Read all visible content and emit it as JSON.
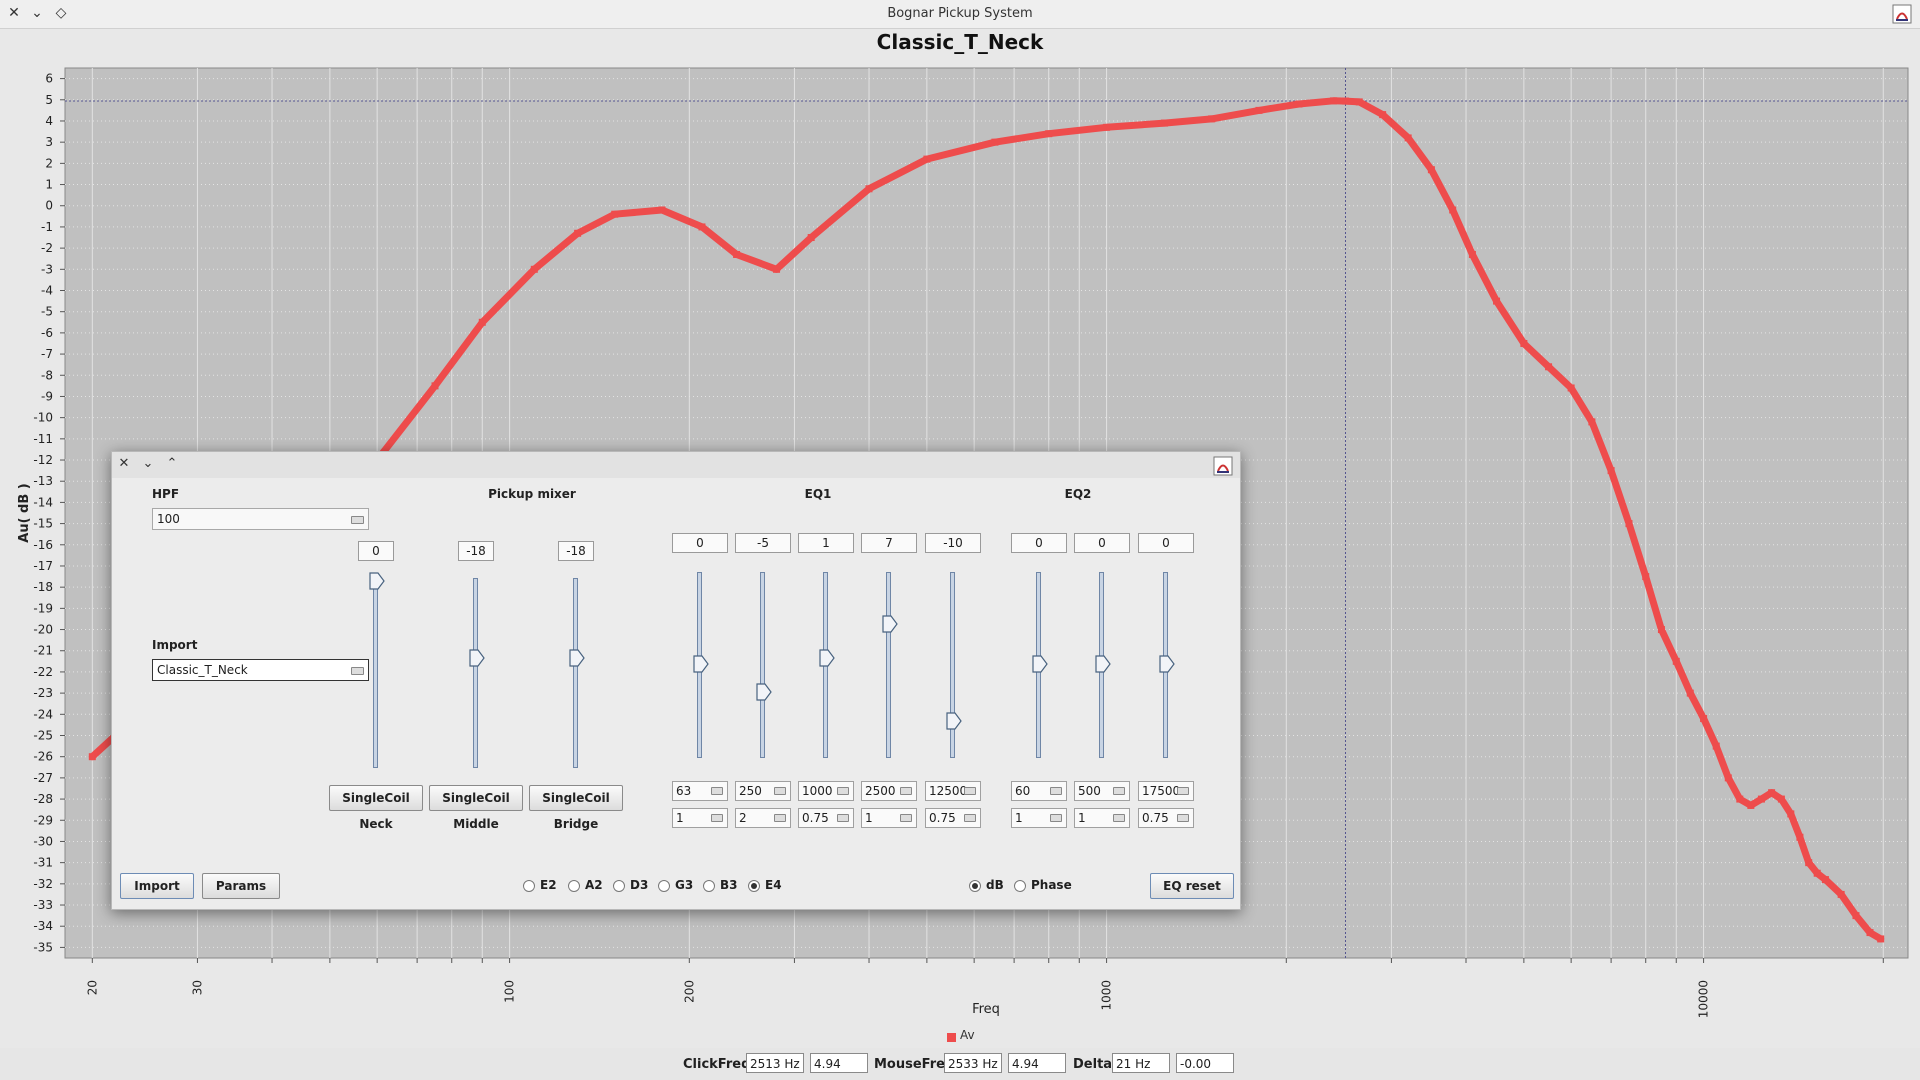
{
  "window": {
    "title": "Bognar Pickup System"
  },
  "chart_data": {
    "type": "line",
    "title": "Classic_T_Neck",
    "xlabel": "Freq",
    "ylabel": "Au( dB )",
    "x_scale": "log",
    "xlim": [
      18,
      22000
    ],
    "ylim": [
      -35.5,
      6.5
    ],
    "x_ticks": [
      20,
      30,
      100,
      200,
      1000,
      10000
    ],
    "y_ticks": [
      6,
      5,
      4,
      3,
      2,
      1,
      0,
      -1,
      -2,
      -3,
      -4,
      -5,
      -6,
      -7,
      -8,
      -9,
      -10,
      -11,
      -12,
      -13,
      -14,
      -15,
      -16,
      -17,
      -18,
      -19,
      -20,
      -21,
      -22,
      -23,
      -24,
      -25,
      -26,
      -27,
      -28,
      -29,
      -30,
      -31,
      -32,
      -33,
      -34,
      -35
    ],
    "grid": true,
    "crosshair": {
      "x": 2513,
      "y": 4.94
    },
    "legend": {
      "position": "bottom-center"
    },
    "series": [
      {
        "name": "Av",
        "color": "#ee4c4c",
        "x": [
          20,
          25,
          32,
          40,
          50,
          60,
          75,
          90,
          110,
          130,
          150,
          180,
          210,
          240,
          280,
          320,
          400,
          500,
          650,
          800,
          1000,
          1250,
          1500,
          1800,
          2100,
          2400,
          2513,
          2650,
          2900,
          3200,
          3500,
          3800,
          4100,
          4500,
          5000,
          5500,
          6000,
          6500,
          7000,
          7500,
          8000,
          8500,
          9000,
          9500,
          10000,
          10500,
          11000,
          11500,
          12000,
          12500,
          13000,
          13500,
          14000,
          14500,
          15000,
          15500,
          16000,
          17000,
          18000,
          19000,
          19800
        ],
        "values": [
          -26,
          -23.5,
          -20.5,
          -17.5,
          -14.5,
          -12,
          -8.5,
          -5.5,
          -3,
          -1.3,
          -0.4,
          -0.2,
          -1,
          -2.3,
          -3,
          -1.5,
          0.8,
          2.2,
          3,
          3.4,
          3.7,
          3.9,
          4.1,
          4.5,
          4.8,
          4.95,
          4.94,
          4.9,
          4.3,
          3.2,
          1.7,
          -0.2,
          -2.3,
          -4.5,
          -6.5,
          -7.6,
          -8.6,
          -10.2,
          -12.5,
          -15,
          -17.5,
          -20,
          -21.5,
          -23,
          -24.2,
          -25.5,
          -27,
          -28,
          -28.3,
          -28,
          -27.7,
          -28,
          -28.7,
          -29.8,
          -31,
          -31.5,
          -31.8,
          -32.5,
          -33.5,
          -34.3,
          -34.6
        ]
      }
    ]
  },
  "status": {
    "clickfreq_label": "ClickFreq:",
    "clickfreq_hz": "2513 Hz",
    "clickfreq_db": "4.94",
    "mousefreq_label": "MouseFreq",
    "mousefreq_hz": "2533 Hz",
    "mousefreq_db": "4.94",
    "delta_label": "Delta:",
    "delta_hz": "21 Hz",
    "delta_db": "-0.00"
  },
  "dialog": {
    "hpf_label": "HPF",
    "hpf_value": "100",
    "import_label": "Import",
    "import_value": "Classic_T_Neck",
    "mixer_label": "Pickup mixer",
    "eq1_label": "EQ1",
    "eq2_label": "EQ2",
    "mixer": [
      {
        "value": "0",
        "level": 0,
        "type": "SingleCoil",
        "name": "Neck"
      },
      {
        "value": "-18",
        "level": -18,
        "type": "SingleCoil",
        "name": "Middle"
      },
      {
        "value": "-18",
        "level": -18,
        "type": "SingleCoil",
        "name": "Bridge"
      }
    ],
    "eq1": [
      {
        "value": "0",
        "level": 0,
        "freq": "63",
        "q": "1"
      },
      {
        "value": "-5",
        "level": -5,
        "freq": "250",
        "q": "2"
      },
      {
        "value": "1",
        "level": 1,
        "freq": "1000",
        "q": "0.75"
      },
      {
        "value": "7",
        "level": 7,
        "freq": "2500",
        "q": "1"
      },
      {
        "value": "-10",
        "level": -10,
        "freq": "12500",
        "q": "0.75"
      }
    ],
    "eq2": [
      {
        "value": "0",
        "level": 0,
        "freq": "60",
        "q": "1"
      },
      {
        "value": "0",
        "level": 0,
        "freq": "500",
        "q": "1"
      },
      {
        "value": "0",
        "level": 0,
        "freq": "17500",
        "q": "0.75"
      }
    ],
    "import_button": "Import",
    "params_button": "Params",
    "strings": [
      "E2",
      "A2",
      "D3",
      "G3",
      "B3",
      "E4"
    ],
    "selected_string": "E4",
    "view_db": "dB",
    "view_phase": "Phase",
    "selected_view": "dB",
    "eq_reset_button": "EQ reset"
  },
  "icons": {
    "close": "close-icon",
    "minimize": "chevron-down-icon",
    "restore": "diamond-icon",
    "app": "java-app-icon"
  }
}
